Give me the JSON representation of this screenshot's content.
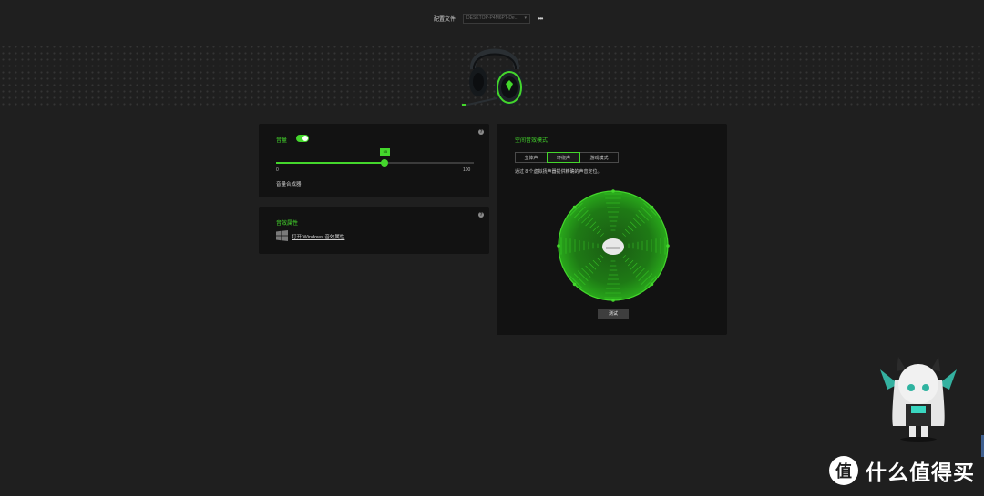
{
  "header": {
    "profile_label": "配置文件",
    "profile_value": "DESKTOP-P4M6PT-De...",
    "more_icon": "more-horizontal-icon"
  },
  "volume_panel": {
    "title": "音量",
    "enabled": true,
    "value": 55,
    "value_label": "55",
    "min_label": "0",
    "max_label": "100",
    "mixer_link": "音量合成器"
  },
  "properties_panel": {
    "title": "音效属性",
    "link": "打开 Windows 音效属性"
  },
  "spatial_panel": {
    "title": "空间音效模式",
    "modes": [
      {
        "label": "立体声",
        "active": false
      },
      {
        "label": "环绕声",
        "active": true
      },
      {
        "label": "游戏模式",
        "active": false
      }
    ],
    "description": "通过 8 个虚拟扬声器提供精确的声音定位。",
    "test_button": "测试"
  },
  "watermark": {
    "text": "什么值得买",
    "logo_char": "值"
  },
  "colors": {
    "accent": "#44d62c",
    "background": "#1f1f1f",
    "panel": "#121212"
  }
}
